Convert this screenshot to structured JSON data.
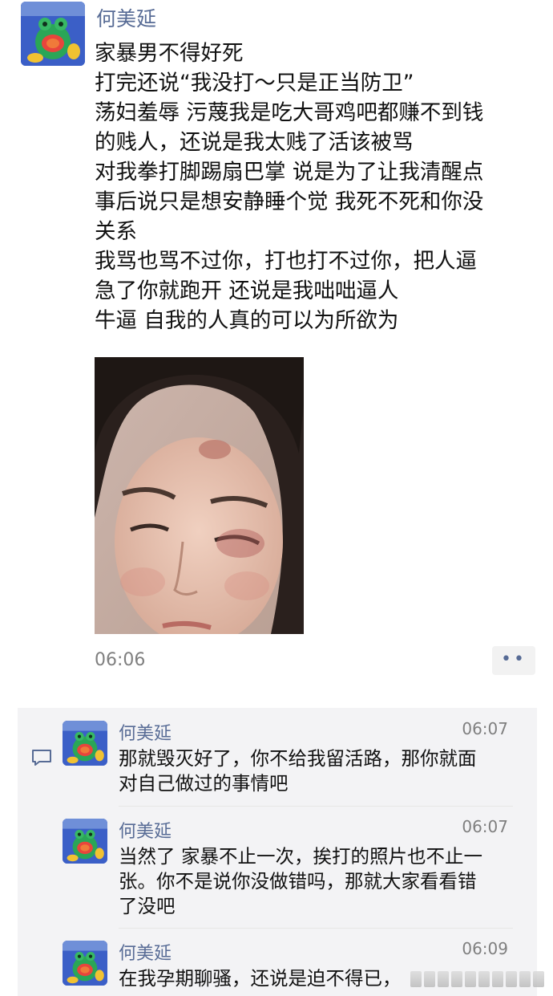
{
  "post": {
    "author": "何美延",
    "menu_dots": "···",
    "lines": [
      "家暴男不得好死",
      "打完还说“我没打～只是正当防卫”",
      "荡妇羞辱 污蔑我是吃大哥鸡吧都赚不到钱",
      "的贱人，还说是我太贱了活该被骂",
      "对我拳打脚踢扇巴掌 说是为了让我清醒点",
      "事后说只是想安静睡个觉 我死不死和你没",
      "关系",
      "我骂也骂不过你，打也打不过你，把人逼",
      "急了你就跑开 还说是我咄咄逼人",
      "牛逼 自我的人真的可以为所欲为"
    ],
    "time": "06:06",
    "more_label": "••"
  },
  "comments": [
    {
      "author": "何美延",
      "time": "06:07",
      "lines": [
        "那就毁灭好了，你不给我留活路，那你就面",
        "对自己做过的事情吧"
      ]
    },
    {
      "author": "何美延",
      "time": "06:07",
      "lines": [
        "当然了 家暴不止一次，挨打的照片也不止一",
        "张。你不是说你没做错吗，那就大家看看错",
        "了没吧"
      ]
    },
    {
      "author": "何美延",
      "time": "06:09",
      "lines": [
        "在我孕期聊骚，还说是迫不得已，"
      ]
    }
  ],
  "colors": {
    "name_link": "#576b95",
    "timestamp": "#7f7f7f",
    "comment_bg": "#f3f3f5"
  }
}
